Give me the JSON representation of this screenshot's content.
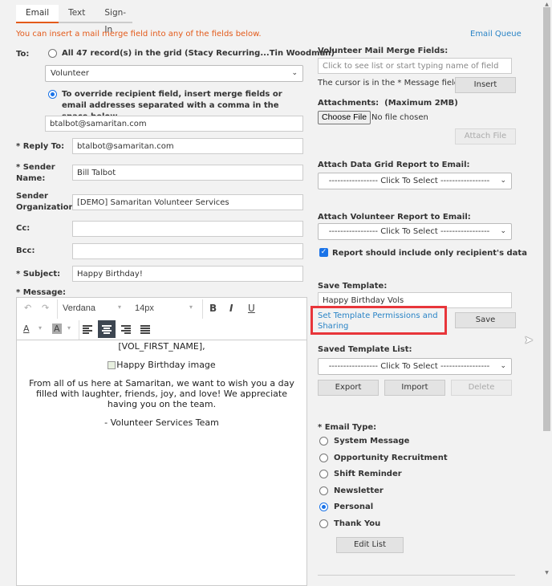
{
  "tabs": [
    {
      "label": "Email",
      "active": true
    },
    {
      "label": "Text",
      "active": false
    },
    {
      "label": "Sign-In",
      "active": false
    }
  ],
  "notice": "You can insert a mail merge field into any of the fields below.",
  "email_queue_link": "Email Queue",
  "to": {
    "label": "To:",
    "all_records_option": "All 47 record(s) in the grid (Stacy Recurring...Tin Woodman)",
    "all_records_selected": false,
    "recipient_field_select": "Volunteer",
    "override_option": "To override recipient field, insert merge fields or email addresses separated with a comma in the space below",
    "override_selected": true,
    "override_value": "btalbot@samaritan.com"
  },
  "fields": {
    "reply_to": {
      "label": "* Reply To:",
      "value": "btalbot@samaritan.com"
    },
    "sender_name": {
      "label_line1": "* Sender",
      "label_line2": "Name:",
      "value": "Bill Talbot"
    },
    "sender_org": {
      "label_line1": "Sender",
      "label_line2": "Organization:",
      "value": "[DEMO] Samaritan Volunteer Services"
    },
    "cc": {
      "label": "Cc:",
      "value": ""
    },
    "bcc": {
      "label": "Bcc:",
      "value": ""
    },
    "subject": {
      "label": "* Subject:",
      "value": "Happy Birthday!"
    },
    "message_label": "* Message:"
  },
  "editor": {
    "font_family": "Verdana",
    "font_size": "14px",
    "bold_label": "B",
    "italic_label": "I",
    "underline_label": "U",
    "font_color_label": "A",
    "bg_color_label": "A",
    "active_alignment": "center",
    "content": {
      "greeting": "[VOL_FIRST_NAME],",
      "image_alt": "Happy Birthday image",
      "body": "From all of us here at Samaritan, we want to wish you a day filled with laughter, friends, joy, and love! We appreciate having you on the team.",
      "signature": "- Volunteer Services Team"
    }
  },
  "merge_fields": {
    "label": "Volunteer Mail Merge Fields:",
    "placeholder": "Click to see list or start typing name of field",
    "cursor_note": "The cursor is in the * Message field.",
    "insert_label": "Insert"
  },
  "attachments": {
    "label": "Attachments:",
    "max_note": "(Maximum 2MB)",
    "choose_file_label": "Choose File",
    "no_file_text": "No file chosen",
    "attach_label": "Attach File"
  },
  "data_grid_report": {
    "label": "Attach Data Grid Report to Email:",
    "selected": "----------------- Click To Select -----------------"
  },
  "volunteer_report": {
    "label": "Attach Volunteer Report to Email:",
    "selected": "----------------- Click To Select -----------------",
    "recipient_only_label": "Report should include only recipient's data",
    "recipient_only_checked": true
  },
  "save_template": {
    "label": "Save Template:",
    "value": "Happy Birthday Vols",
    "permissions_link": "Set Template Permissions and Sharing",
    "save_label": "Save"
  },
  "saved_templates": {
    "label": "Saved Template List:",
    "selected": "----------------- Click To Select -----------------",
    "export_label": "Export",
    "import_label": "Import",
    "delete_label": "Delete"
  },
  "email_type": {
    "label": "* Email Type:",
    "options": [
      {
        "label": "System Message",
        "selected": false
      },
      {
        "label": "Opportunity Recruitment",
        "selected": false
      },
      {
        "label": "Shift Reminder",
        "selected": false
      },
      {
        "label": "Newsletter",
        "selected": false
      },
      {
        "label": "Personal",
        "selected": true
      },
      {
        "label": "Thank You",
        "selected": false
      }
    ],
    "edit_list_label": "Edit List"
  },
  "colors": {
    "accent_orange": "#e35a1a",
    "link_blue": "#2a84c6",
    "radio_blue": "#1a73e8",
    "highlight_red": "#e8353a"
  }
}
